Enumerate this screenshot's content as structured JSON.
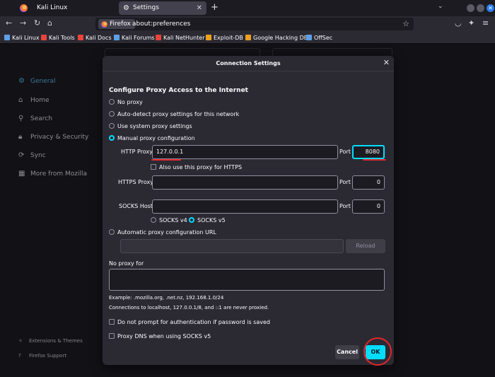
{
  "colors": {
    "accent": "#00ddff",
    "annotation": "#e2262b"
  },
  "tabs": [
    {
      "label": "Kali Linux"
    },
    {
      "label": "Settings",
      "icon": "gear-icon"
    }
  ],
  "navbar": {
    "identity_label": "Firefox",
    "url": "about:preferences"
  },
  "bookmarks": [
    {
      "label": "Kali Linux",
      "color": "#5ea0e8"
    },
    {
      "label": "Kali Tools",
      "color": "#e8443a"
    },
    {
      "label": "Kali Docs",
      "color": "#e8443a"
    },
    {
      "label": "Kali Forums",
      "color": "#5ea0e8"
    },
    {
      "label": "Kali NetHunter",
      "color": "#e8443a"
    },
    {
      "label": "Exploit-DB",
      "color": "#f0a020"
    },
    {
      "label": "Google Hacking DB",
      "color": "#f0a020"
    },
    {
      "label": "OffSec",
      "color": "#5ea0e8"
    }
  ],
  "sidebar": {
    "items": [
      {
        "label": "General",
        "icon": "gear-icon",
        "active": true
      },
      {
        "label": "Home",
        "icon": "home-icon"
      },
      {
        "label": "Search",
        "icon": "search-icon"
      },
      {
        "label": "Privacy & Security",
        "icon": "lock-icon"
      },
      {
        "label": "Sync",
        "icon": "sync-icon"
      },
      {
        "label": "More from Mozilla",
        "icon": "mozilla-icon"
      }
    ],
    "footer": [
      {
        "label": "Extensions & Themes",
        "icon": "puzzle-icon"
      },
      {
        "label": "Firefox Support",
        "icon": "help-icon"
      }
    ]
  },
  "dialog": {
    "title": "Connection Settings",
    "section_heading": "Configure Proxy Access to the Internet",
    "proxy_options": [
      {
        "label": "No proxy",
        "checked": false
      },
      {
        "label": "Auto-detect proxy settings for this network",
        "checked": false
      },
      {
        "label": "Use system proxy settings",
        "checked": false
      },
      {
        "label": "Manual proxy configuration",
        "checked": true
      }
    ],
    "http_proxy_label": "HTTP Proxy",
    "http_proxy_value": "127.0.0.1",
    "port_label": "Port",
    "http_port_value": "8080",
    "also_https_label": "Also use this proxy for HTTPS",
    "https_proxy_label": "HTTPS Proxy",
    "https_proxy_value": "",
    "https_port_value": "0",
    "socks_host_label": "SOCKS Host",
    "socks_host_value": "",
    "socks_port_value": "0",
    "socks_v4_label": "SOCKS v4",
    "socks_v5_label": "SOCKS v5",
    "auto_config_label": "Automatic proxy configuration URL",
    "auto_config_value": "",
    "reload_label": "Reload",
    "no_proxy_label": "No proxy for",
    "no_proxy_value": "",
    "example_text": "Example: .mozilla.org, .net.nz, 192.168.1.0/24",
    "localhost_text": "Connections to localhost, 127.0.0.1/8, and ::1 are never proxied.",
    "no_prompt_label": "Do not prompt for authentication if password is saved",
    "proxy_dns_label": "Proxy DNS when using SOCKS v5",
    "cancel_label": "Cancel",
    "ok_label": "OK"
  }
}
